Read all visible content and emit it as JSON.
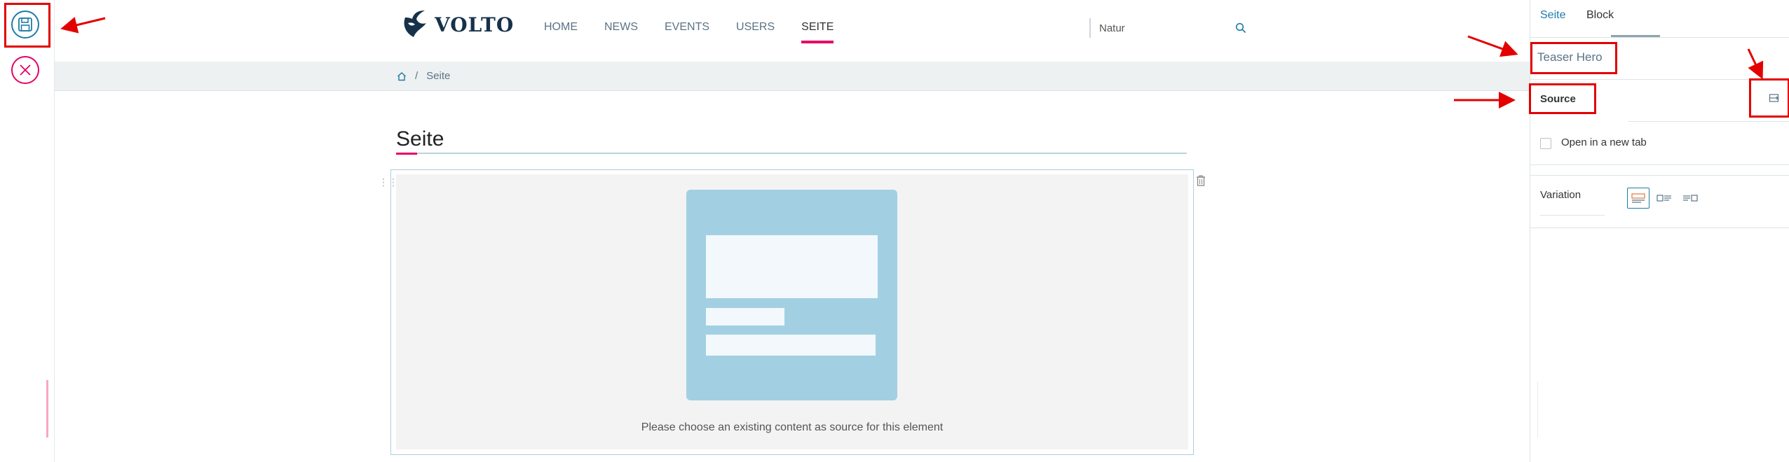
{
  "brand": {
    "logo_text": "VOLTO",
    "accent_color": "#e40166",
    "primary_color": "#1e7ca6"
  },
  "toolbar": {
    "save_icon": "save-icon",
    "cancel_icon": "close-icon"
  },
  "nav": {
    "items": [
      "HOME",
      "NEWS",
      "EVENTS",
      "USERS",
      "SEITE"
    ],
    "active": "SEITE"
  },
  "search": {
    "value": "Natur",
    "icon": "search-icon"
  },
  "breadcrumb": {
    "home_icon": "home-icon",
    "separator": "/",
    "current": "Seite"
  },
  "page": {
    "title": "Seite"
  },
  "block": {
    "placeholder_message": "Please choose an existing content as source for this element"
  },
  "sidebar": {
    "tabs": [
      "Seite",
      "Block"
    ],
    "active_tab": "Block",
    "block_title": "Teaser Hero",
    "source_label": "Source",
    "open_new_tab_label": "Open in a new tab",
    "variation_label": "Variation"
  }
}
